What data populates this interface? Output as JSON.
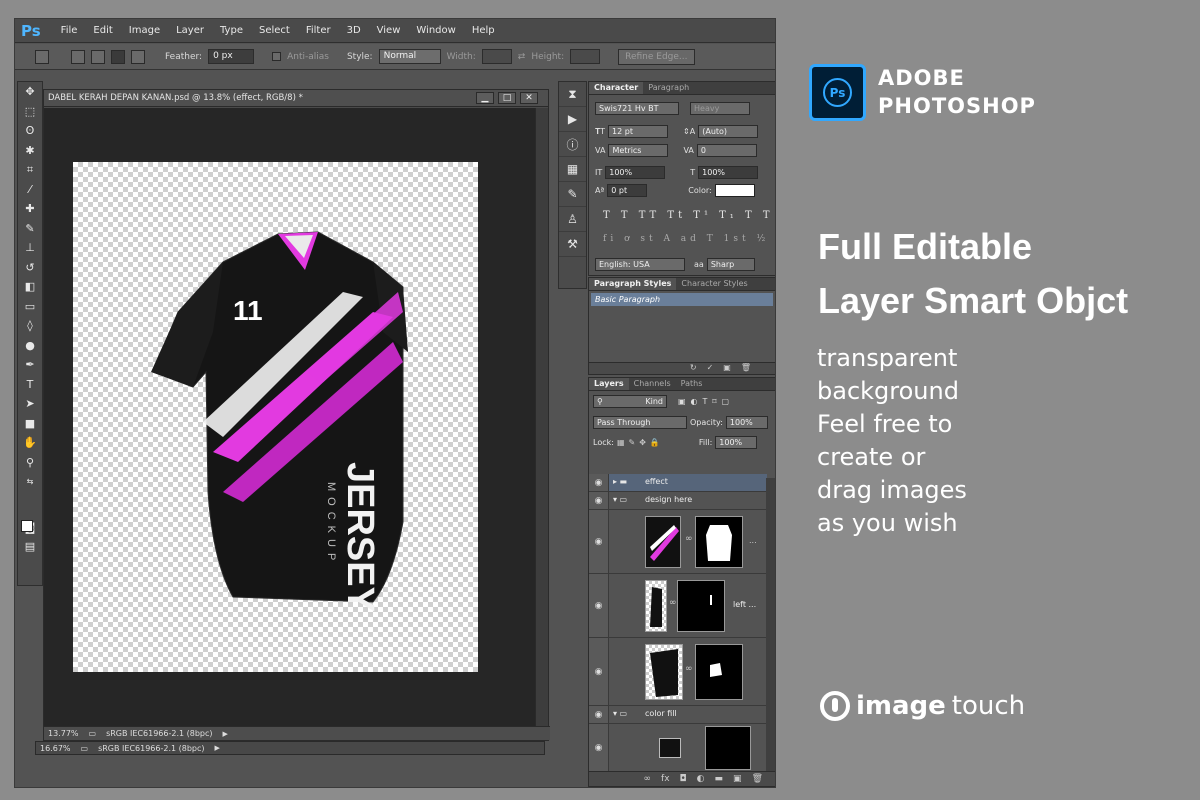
{
  "menu": {
    "logo": "Ps",
    "items": [
      "File",
      "Edit",
      "Image",
      "Layer",
      "Type",
      "Select",
      "Filter",
      "3D",
      "View",
      "Window",
      "Help"
    ]
  },
  "options": {
    "feather_label": "Feather:",
    "feather_value": "0 px",
    "antialias_label": "Anti-alias",
    "style_label": "Style:",
    "style_value": "Normal",
    "width_label": "Width:",
    "height_label": "Height:",
    "refine_label": "Refine Edge..."
  },
  "document": {
    "title": "DABEL KERAH DEPAN KANAN.psd @ 13.8% (effect, RGB/8) *",
    "status1_zoom": "13.77%",
    "status1_profile": "sRGB IEC61966-2.1 (8bpc)",
    "status2_zoom": "16.67%",
    "status2_profile": "sRGB IEC61966-2.1 (8bpc)"
  },
  "jersey": {
    "number": "11",
    "side_text": "JERSEY",
    "side_sub": "MOCKUP",
    "colors": {
      "base": "#141414",
      "accent": "#e23ae0",
      "white": "#f2f2f2"
    }
  },
  "character": {
    "tabs": [
      "Character",
      "Paragraph"
    ],
    "font_family": "Swis721 Hv BT",
    "font_style": "Heavy",
    "size": "12 pt",
    "leading": "(Auto)",
    "kerning": "Metrics",
    "tracking": "0",
    "vscale": "100%",
    "hscale": "100%",
    "baseline": "0 pt",
    "color_label": "Color:",
    "style_buttons": "T T TT Tt T¹ T₁ T T",
    "opentype_buttons": "fi ơ st A ad T 1st ½",
    "language": "English: USA",
    "aa_label": "aa",
    "antialias": "Sharp"
  },
  "paragraph_styles": {
    "tabs": [
      "Paragraph Styles",
      "Character Styles"
    ],
    "selected": "Basic Paragraph"
  },
  "layers": {
    "tabs": [
      "Layers",
      "Channels",
      "Paths"
    ],
    "kind": "Kind",
    "blend_mode": "Pass Through",
    "opacity_label": "Opacity:",
    "opacity": "100%",
    "lock_label": "Lock:",
    "fill_label": "Fill:",
    "fill": "100%",
    "items": [
      {
        "name": "effect",
        "type": "group",
        "expanded": false
      },
      {
        "name": "design here",
        "type": "group",
        "expanded": true
      },
      {
        "name": "",
        "type": "smart"
      },
      {
        "name": "left ...",
        "type": "smart"
      },
      {
        "name": "",
        "type": "smart"
      },
      {
        "name": "color fill",
        "type": "group",
        "expanded": true
      },
      {
        "name": "",
        "type": "fill"
      }
    ]
  },
  "promo": {
    "brand_line1": "ADOBE",
    "brand_line2": "PHOTOSHOP",
    "headline1": "Full Editable",
    "headline2": "Layer Smart Objct",
    "sub_lines": [
      "transparent",
      "background",
      "Feel free to",
      "create or",
      "drag images",
      "as you wish"
    ],
    "footer_logo_bold": "image",
    "footer_logo_light": "touch",
    "ps_icon_text": "Ps"
  }
}
